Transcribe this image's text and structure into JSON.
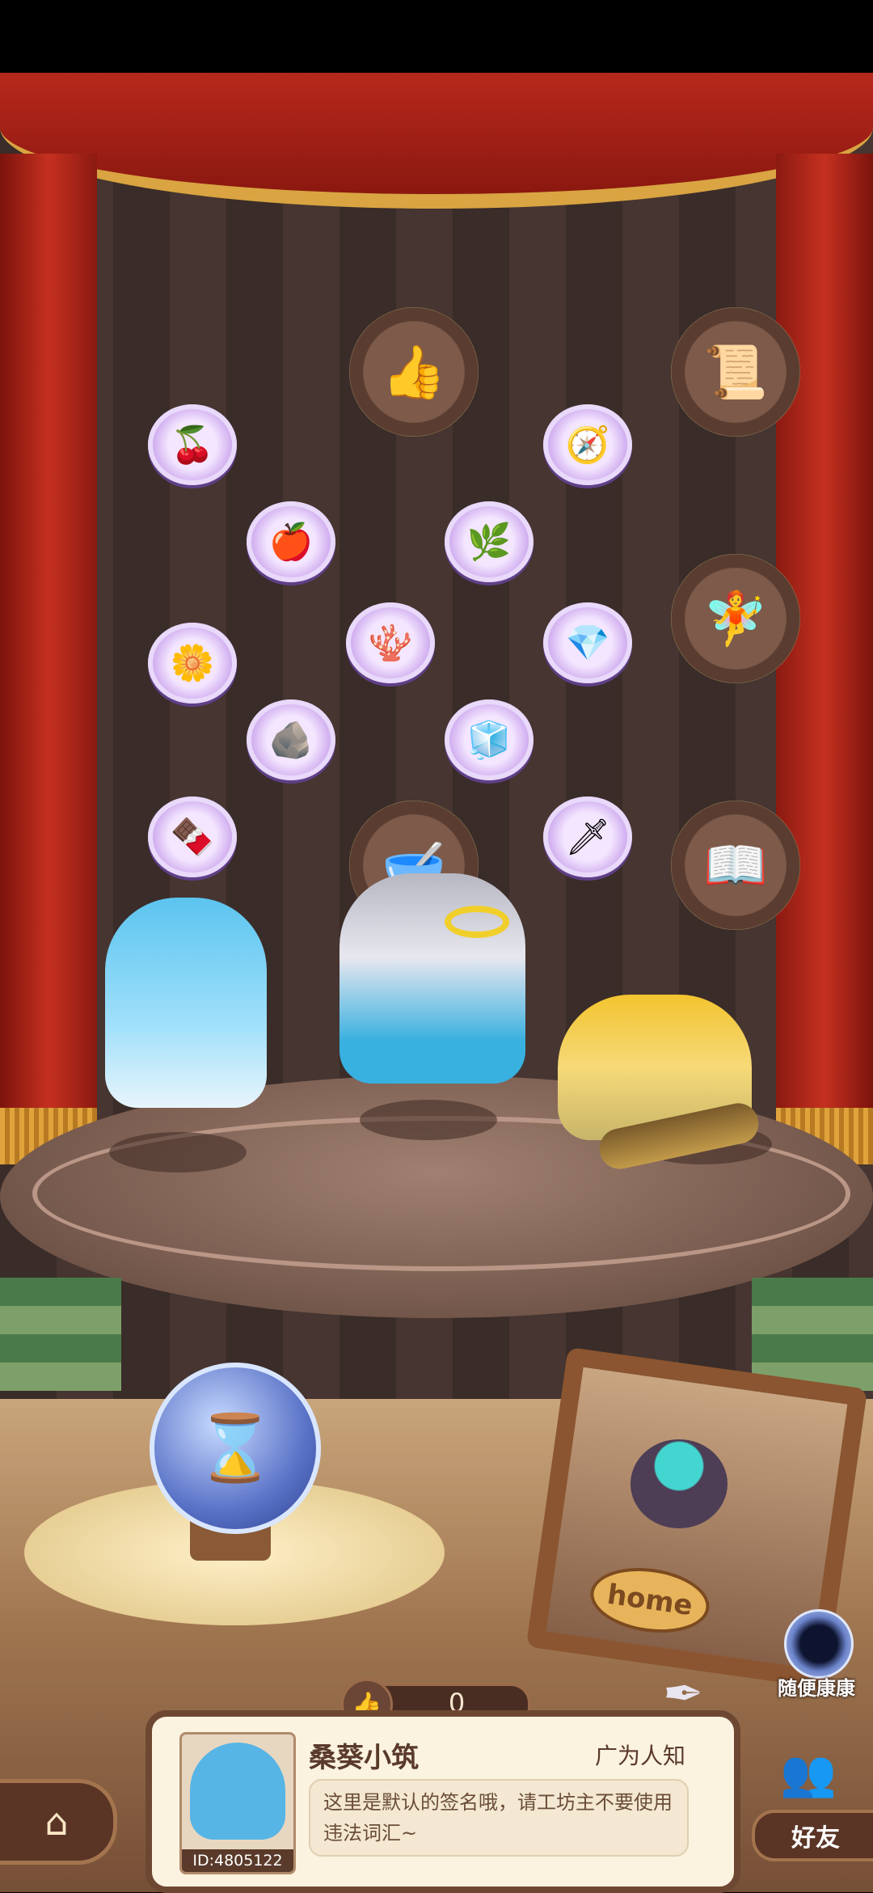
{
  "room": {
    "items": [
      {
        "name": "red-berries-item",
        "glyph": "🍒"
      },
      {
        "name": "apple-item",
        "glyph": "🍎"
      },
      {
        "name": "herb-item",
        "glyph": "🌿"
      },
      {
        "name": "compass-item",
        "glyph": "🧭"
      },
      {
        "name": "golden-flower-item",
        "glyph": "🌼"
      },
      {
        "name": "purple-coral-item",
        "glyph": "🪸"
      },
      {
        "name": "blue-crystal-item",
        "glyph": "💎"
      },
      {
        "name": "ore-item",
        "glyph": "🪨"
      },
      {
        "name": "silver-ore-item",
        "glyph": "🧊"
      },
      {
        "name": "chocolate-item",
        "glyph": "🍫"
      },
      {
        "name": "obsidian-item",
        "glyph": "🗡"
      }
    ],
    "badges": [
      {
        "name": "thumbs-up-badge",
        "glyph": "👍"
      },
      {
        "name": "certificate-badge",
        "glyph": "📜"
      },
      {
        "name": "character-badge",
        "glyph": "🧚"
      },
      {
        "name": "cauldron-badge",
        "glyph": "🥣"
      },
      {
        "name": "book-badge",
        "glyph": "📖"
      }
    ],
    "orb_glyph": "⌛",
    "home_sign": "home"
  },
  "profile": {
    "likes": "0",
    "like_icon": "👍",
    "name": "桑葵小筑",
    "fame": "广为人知",
    "signature": "这里是默认的签名哦，请工坊主不要使用违法词汇~",
    "id": "ID:4805122"
  },
  "nav": {
    "home_icon": "⌂",
    "random_label": "随便康康",
    "friends_label": "好友",
    "friends_icon": "👥",
    "quill_icon": "✒"
  }
}
